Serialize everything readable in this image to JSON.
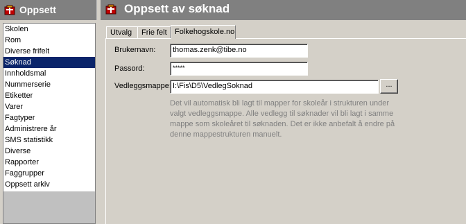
{
  "nav": {
    "title": "Oppsett",
    "items": [
      "Skolen",
      "Rom",
      "Diverse frifelt",
      "Søknad",
      "Innholdsmal",
      "Nummerserie",
      "Etiketter",
      "Varer",
      "Fagtyper",
      "Administrere år",
      "SMS statistikk",
      "Diverse",
      "Rapporter",
      "Faggrupper",
      "Oppsett arkiv"
    ],
    "selected": "Søknad"
  },
  "page": {
    "title": "Oppsett av søknad",
    "tabs": [
      "Utvalg",
      "Frie felt",
      "Folkehogskole.no"
    ],
    "active_tab": "Folkehogskole.no"
  },
  "form": {
    "username_label": "Brukernavn:",
    "username_value": "thomas.zenk@tibe.no",
    "password_label": "Passord:",
    "password_value": "*****",
    "folder_label": "Vedleggsmappe:",
    "folder_value": "I:\\Fis\\D5\\VedlegSoknad",
    "browse_label": "...",
    "note": "Det vil automatisk bli lagt til mapper for skoleår i strukturen under valgt vedleggsmappe. Alle vedlegg til søknader vil bli lagt i samme mappe som skoleåret til søknaden. Det er ikke anbefalt å endre på denne mappestrukturen manuelt."
  },
  "colors": {
    "header_bg": "#808080",
    "selection": "#0a246a",
    "face": "#d4d0c8"
  }
}
